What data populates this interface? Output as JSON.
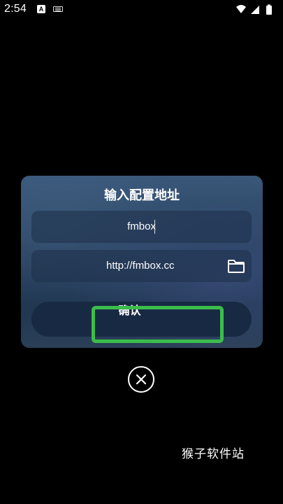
{
  "status_bar": {
    "time": "2:54",
    "icons": [
      "notification-a-icon",
      "keyboard-icon",
      "wifi-icon",
      "signal-icon",
      "battery-icon"
    ]
  },
  "dialog": {
    "title": "输入配置地址",
    "name_field": {
      "value": "fmbox"
    },
    "url_field": {
      "value": "http://fmbox.cc",
      "icon": "folder-icon"
    },
    "confirm_label": "确认"
  },
  "close_icon": "close-icon",
  "watermark": "猴子软件站",
  "colors": {
    "highlight": "#3cbd4c",
    "dialog_top": "#3a587a",
    "button": "#182a43"
  }
}
